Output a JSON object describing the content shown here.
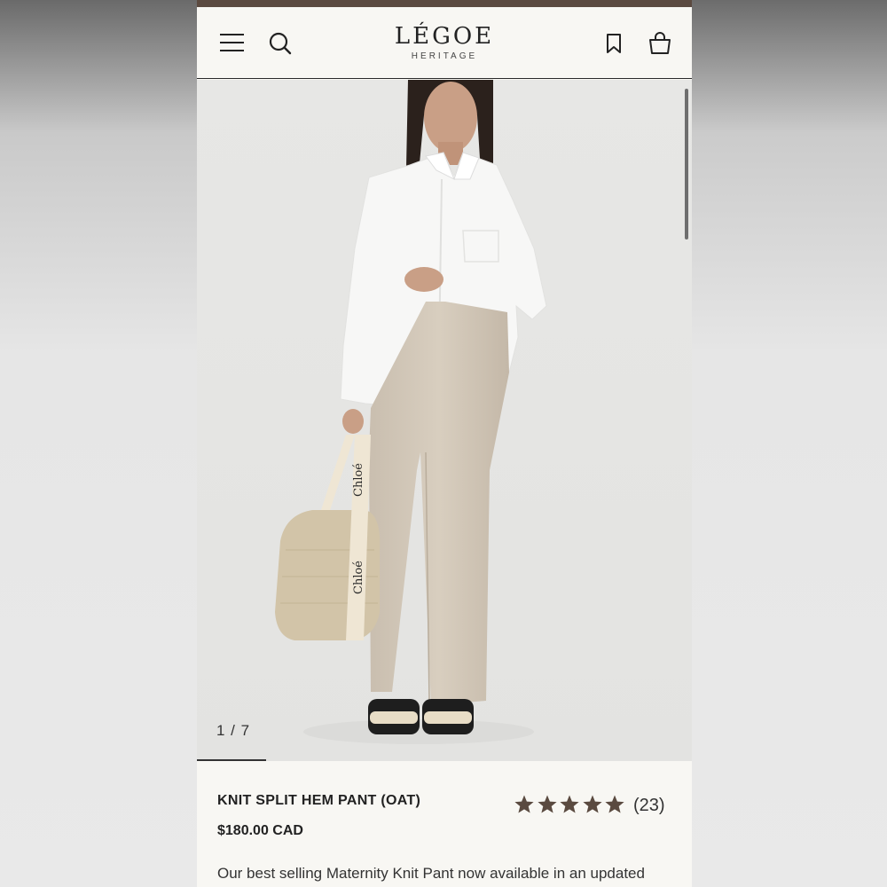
{
  "header": {
    "brand_name": "LÉGOE",
    "brand_sub": "HERITAGE"
  },
  "gallery": {
    "counter": "1 / 7",
    "bag_strap_text": "Chloé"
  },
  "product": {
    "title": "KNIT SPLIT HEM PANT (OAT)",
    "price": "$180.00 CAD",
    "rating": 5,
    "review_count": "(23)",
    "description": "Our best selling Maternity Knit Pant now available in an updated"
  },
  "colors": {
    "accent_bar": "#5b4a40",
    "star": "#5a4a40"
  }
}
